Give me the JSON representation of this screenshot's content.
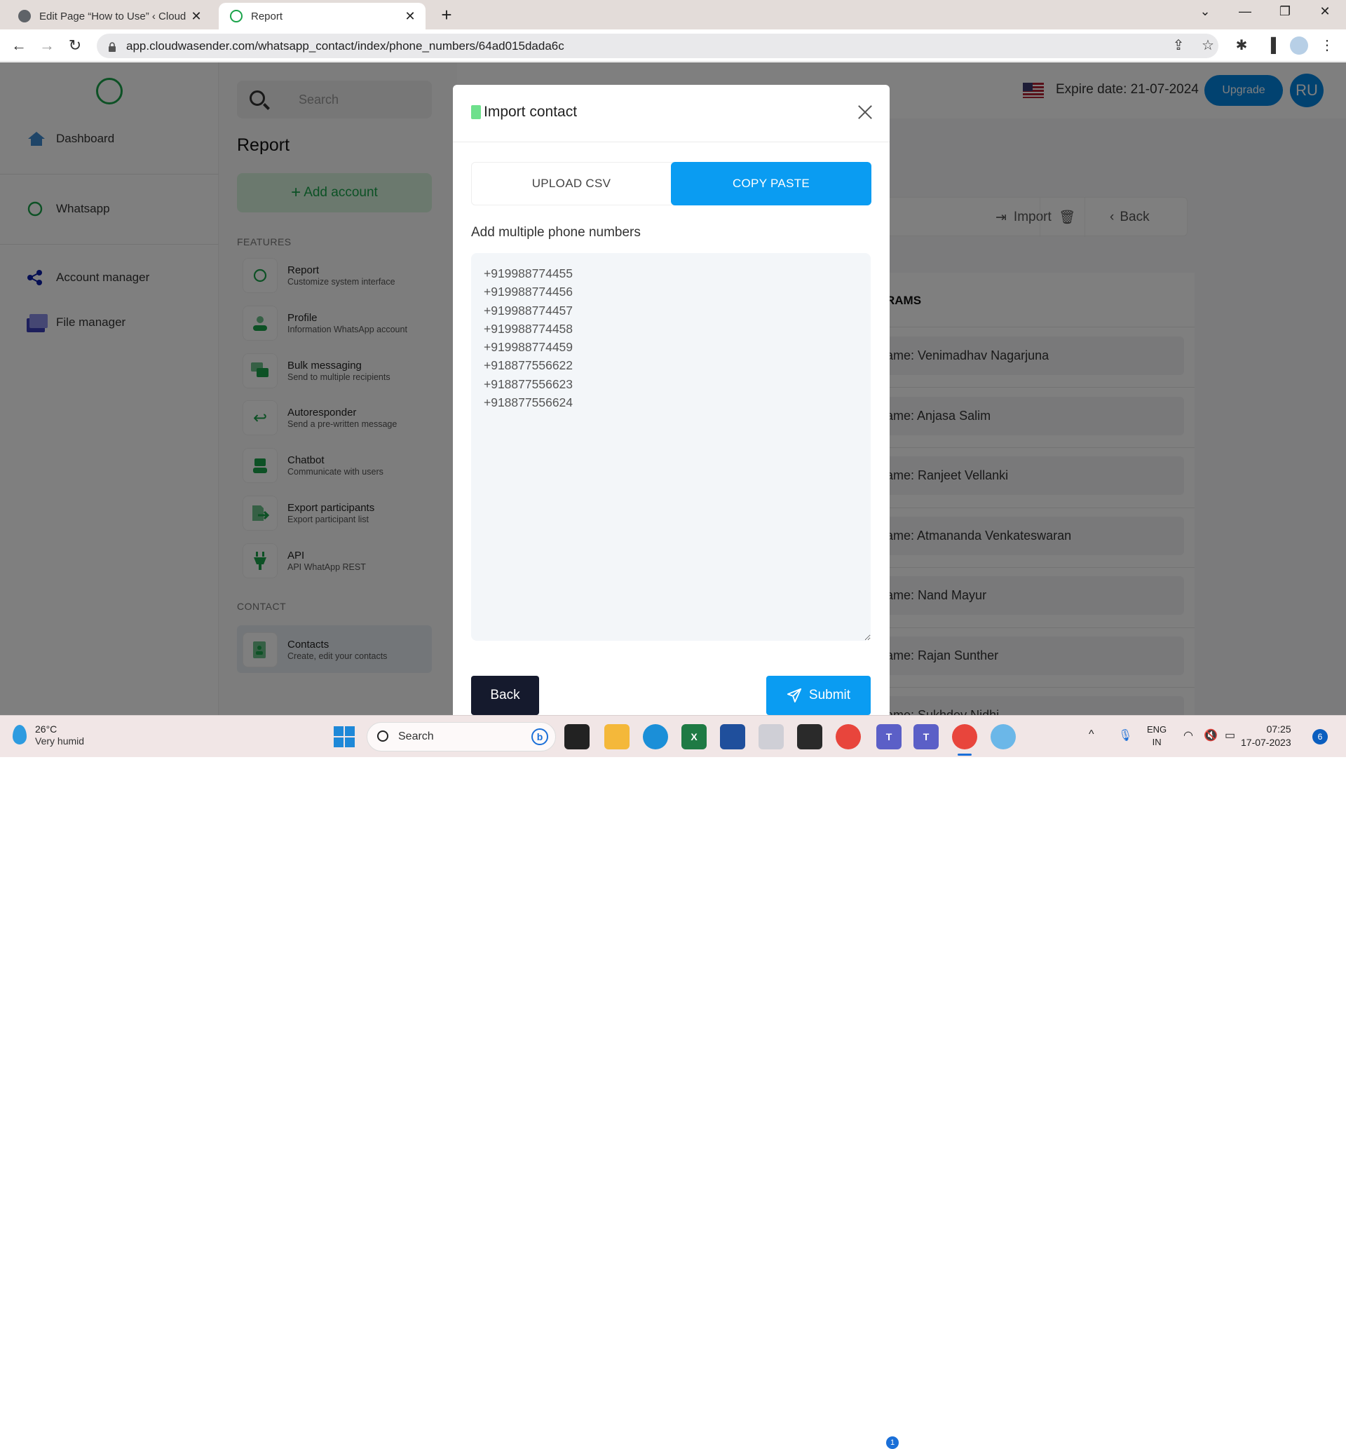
{
  "browser": {
    "tabs": [
      {
        "title": "Edit Page “How to Use” ‹ Cloud W",
        "active": false,
        "icon": "globe-icon"
      },
      {
        "title": "Report",
        "active": true,
        "icon": "whatsapp-rocket-icon"
      }
    ],
    "url": "app.cloudwasender.com/whatsapp_contact/index/phone_numbers/64ad015dada6c"
  },
  "sidebar": {
    "items": [
      {
        "label": "Dashboard",
        "icon": "home-icon"
      },
      {
        "label": "Whatsapp",
        "icon": "whatsapp-icon"
      },
      {
        "label": "Account manager",
        "icon": "share-icon"
      },
      {
        "label": "File manager",
        "icon": "folder-icon"
      }
    ]
  },
  "panel": {
    "search_placeholder": "Search",
    "title": "Report",
    "add_account": "Add account",
    "features_label": "FEATURES",
    "features": [
      {
        "title": "Report",
        "subtitle": "Customize system interface",
        "icon": "whatsapp-icon"
      },
      {
        "title": "Profile",
        "subtitle": "Information WhatsApp account",
        "icon": "user-icon"
      },
      {
        "title": "Bulk messaging",
        "subtitle": "Send to multiple recipients",
        "icon": "chat-bubbles-icon"
      },
      {
        "title": "Autoresponder",
        "subtitle": "Send a pre-written message",
        "icon": "reply-all-icon"
      },
      {
        "title": "Chatbot",
        "subtitle": "Communicate with users",
        "icon": "robot-icon"
      },
      {
        "title": "Export participants",
        "subtitle": "Export participant list",
        "icon": "file-export-icon"
      },
      {
        "title": "API",
        "subtitle": "API WhatApp REST",
        "icon": "plug-icon"
      }
    ],
    "contact_label": "CONTACT",
    "contacts": {
      "title": "Contacts",
      "subtitle": "Create, edit your contacts",
      "icon": "address-book-icon"
    }
  },
  "topbar": {
    "expire": "Expire date: 21-07-2024",
    "upgrade": "Upgrade",
    "avatar": "RU"
  },
  "actions": {
    "import": "Import",
    "back": "Back"
  },
  "list": {
    "heading": "RAMS",
    "rows": [
      "ame: Venimadhav Nagarjuna",
      "ame: Anjasa Salim",
      "ame: Ranjeet Vellanki",
      "ame: Atmananda Venkateswaran",
      "ame: Nand Mayur",
      "ame: Rajan Sunther",
      "ame: Sukhdev Nidhi"
    ]
  },
  "modal": {
    "title": "Import contact",
    "tabs": [
      {
        "label": "UPLOAD CSV",
        "active": false
      },
      {
        "label": "COPY PASTE",
        "active": true
      }
    ],
    "field_label": "Add multiple phone numbers",
    "phone_numbers": "+919988774455\n+919988774456\n+919988774457\n+919988774458\n+919988774459\n+918877556622\n+918877556623\n+918877556624",
    "back": "Back",
    "submit": "Submit",
    "accent_color": "#0a9cf2"
  },
  "taskbar": {
    "weather_temp": "26°C",
    "weather_desc": "Very humid",
    "search": "Search",
    "teams_badge": "1",
    "lang_1": "ENG",
    "lang_2": "IN",
    "time": "07:25",
    "date": "17-07-2023",
    "notifications": "6"
  }
}
